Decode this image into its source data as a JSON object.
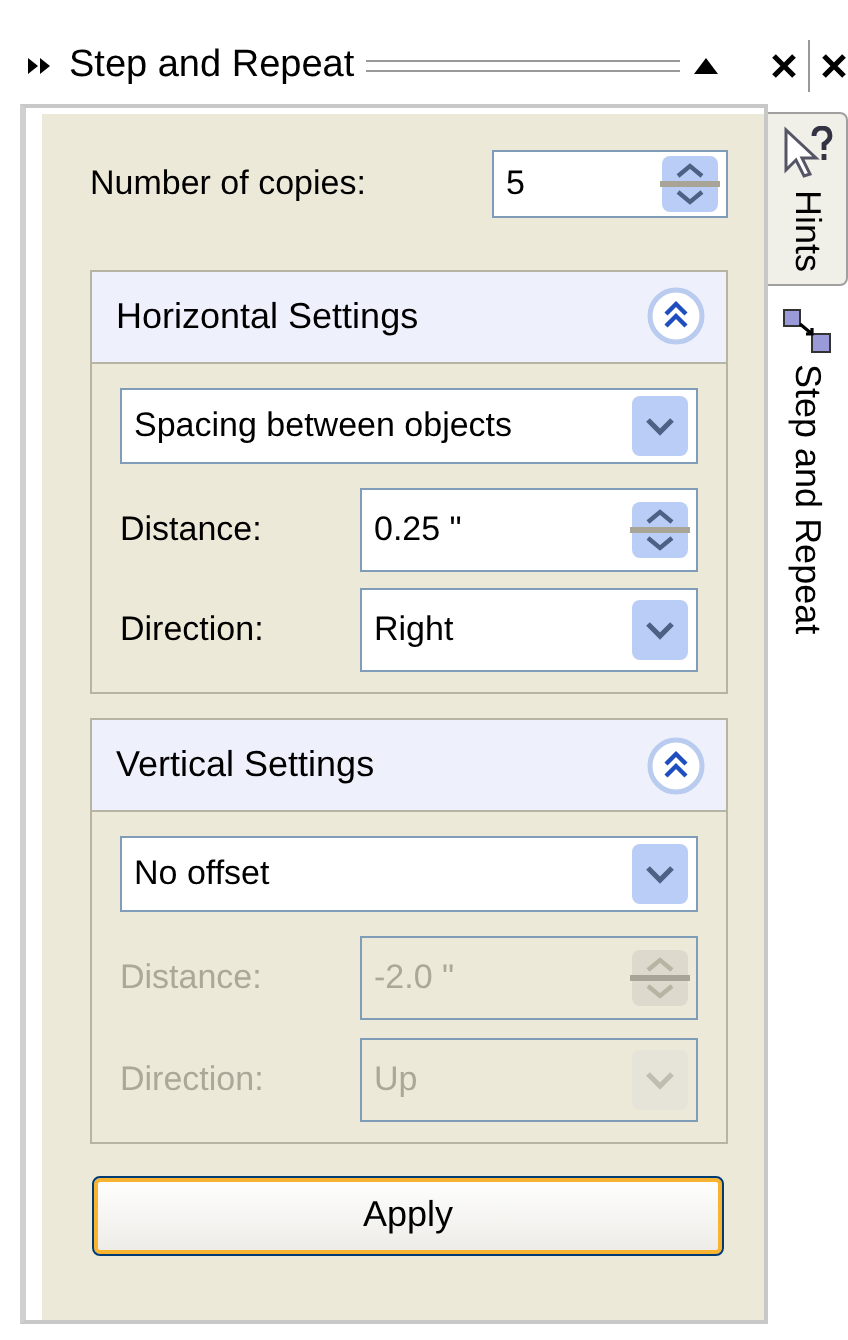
{
  "docker": {
    "title": "Step and Repeat"
  },
  "side_tabs": [
    {
      "label": "Hints",
      "selected": false
    },
    {
      "label": "Step and Repeat",
      "selected": true
    }
  ],
  "copies": {
    "label": "Number of copies:",
    "value": "5"
  },
  "groups": [
    {
      "title": "Horizontal Settings",
      "expanded": true,
      "mode": "Spacing between objects",
      "disabled": false,
      "fields": [
        {
          "kind": "spin",
          "label": "Distance:",
          "value": "0.25 \""
        },
        {
          "kind": "select",
          "label": "Direction:",
          "value": "Right"
        }
      ]
    },
    {
      "title": "Vertical Settings",
      "expanded": true,
      "mode": "No offset",
      "disabled": true,
      "fields": [
        {
          "kind": "spin",
          "label": "Distance:",
          "value": "-2.0 \""
        },
        {
          "kind": "select",
          "label": "Direction:",
          "value": "Up"
        }
      ]
    }
  ],
  "apply_button": "Apply"
}
